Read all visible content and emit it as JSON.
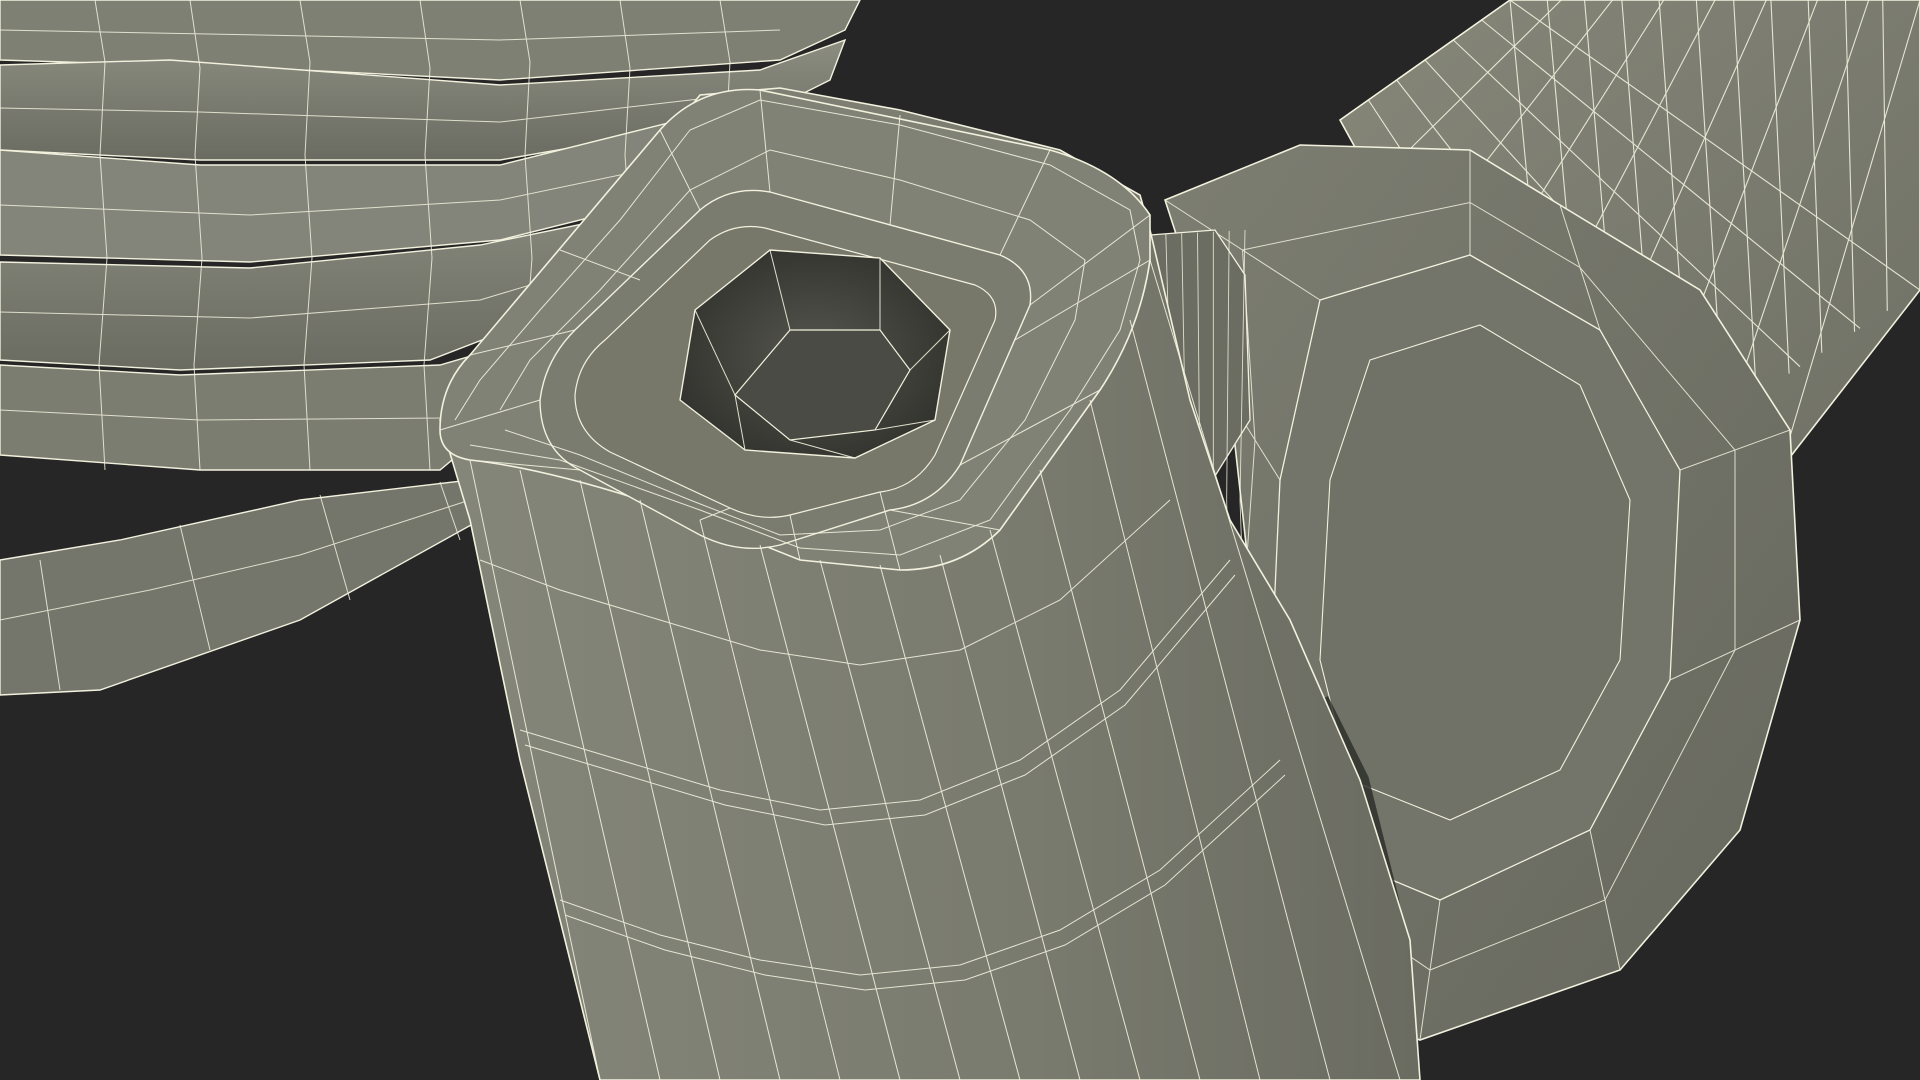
{
  "scene": {
    "background_color": "#262626",
    "surface_color": "#7b7c70",
    "surface_light_color": "#898a7e",
    "surface_shadow_color": "#5f6056",
    "cavity_color": "#3e3f39",
    "wire_color": "#f2f1de",
    "objects": [
      "coil-spring",
      "square-socket-body",
      "hex-socket-hole",
      "pivot-hex-hub",
      "tube-arm"
    ]
  }
}
